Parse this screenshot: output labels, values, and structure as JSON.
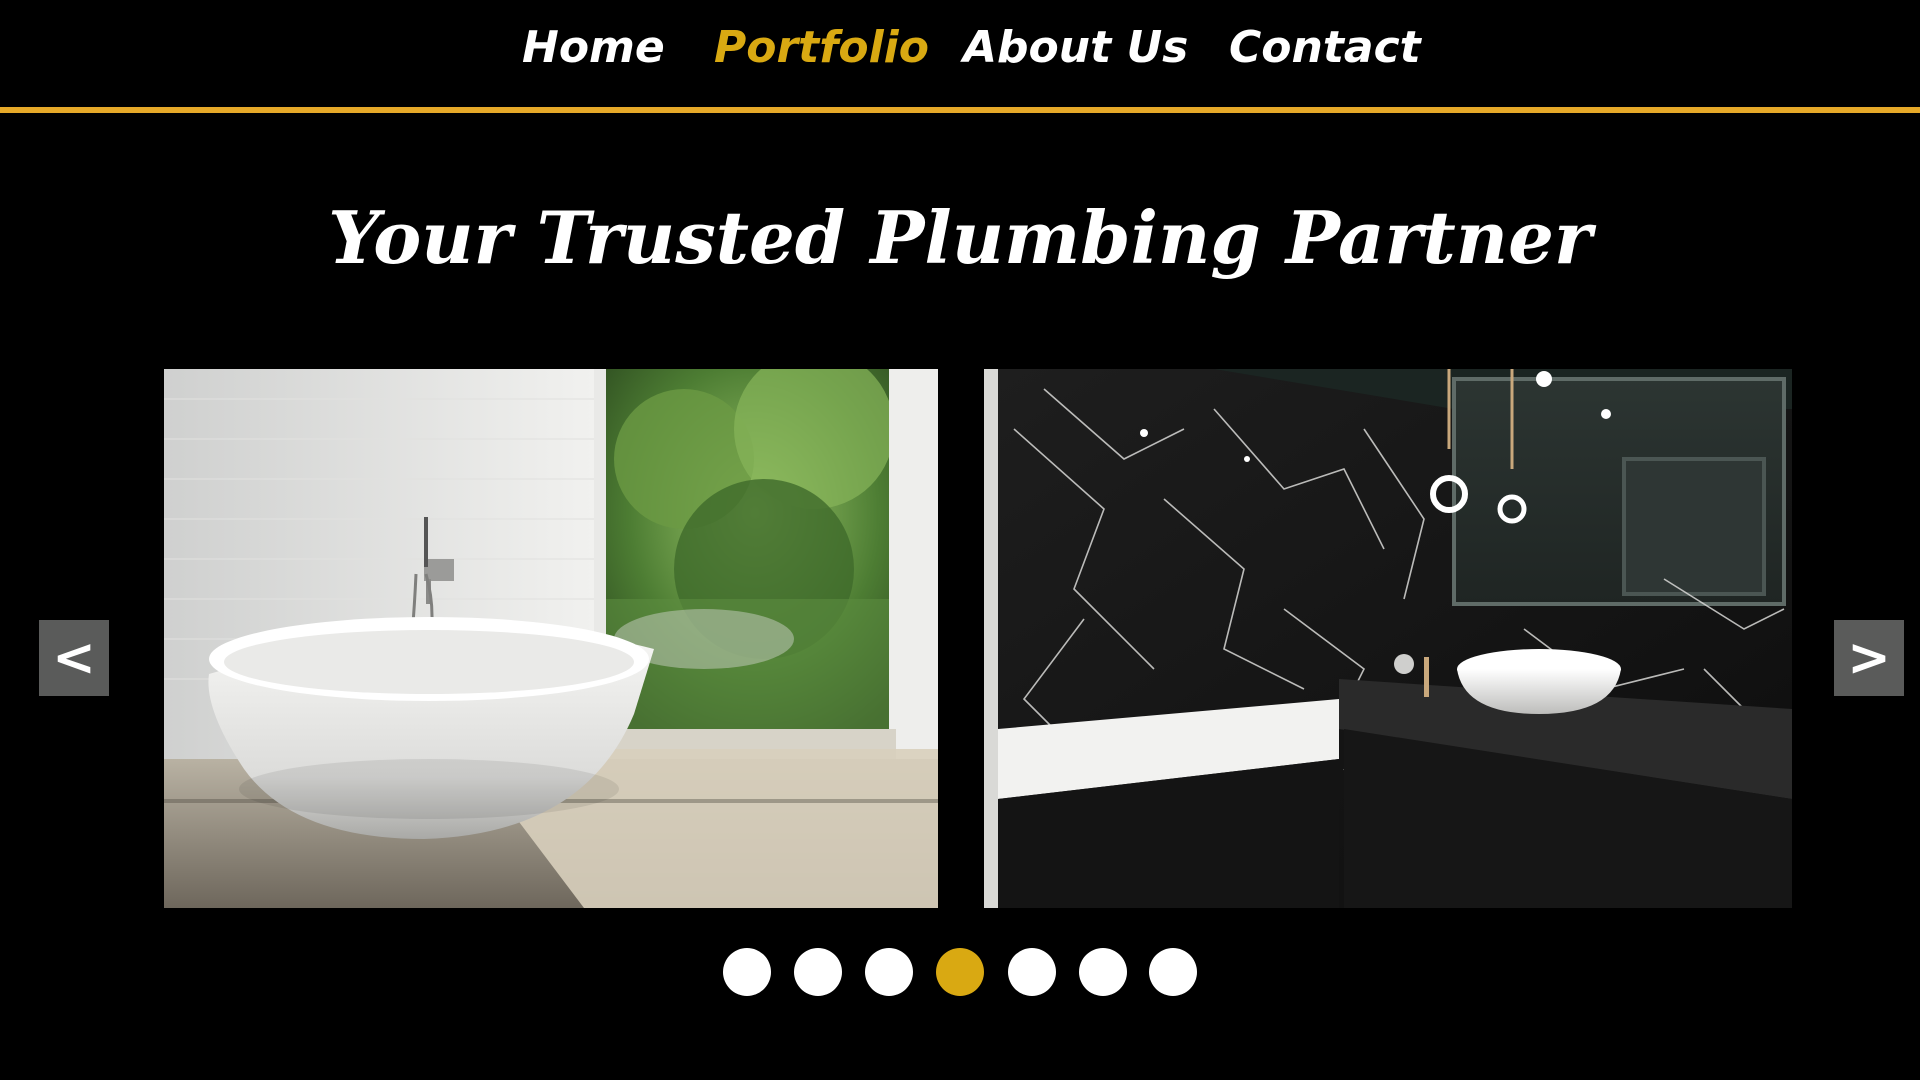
{
  "nav": {
    "items": [
      {
        "label": "Home",
        "active": false
      },
      {
        "label": "Portfolio",
        "active": true
      },
      {
        "label": "About Us",
        "active": false
      },
      {
        "label": "Contact",
        "active": false
      }
    ]
  },
  "hero": {
    "title": "Your Trusted Plumbing Partner"
  },
  "carousel": {
    "prev_label": "<",
    "next_label": ">",
    "slide_count": 7,
    "active_index": 4,
    "slides": [
      {
        "icon": "freestanding-bathtub-photo"
      },
      {
        "icon": "black-marble-bathroom-photo"
      }
    ]
  },
  "colors": {
    "background": "#000000",
    "accent": "#d9a912",
    "divider": "#e7a929",
    "text": "#ffffff",
    "arrow_bg": "#5a5b5a"
  }
}
